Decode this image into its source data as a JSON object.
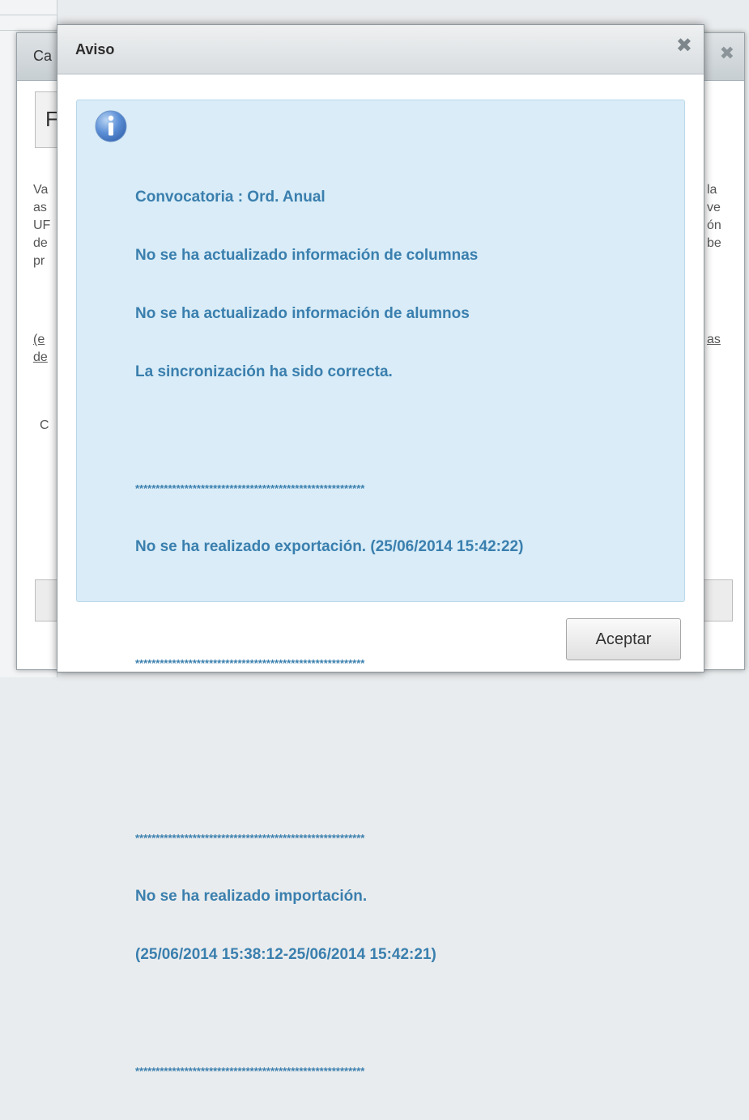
{
  "background_dialog": {
    "title": "Ca",
    "close_icon": "✖",
    "box_text": "F",
    "left_text": [
      "Va",
      "as",
      "UF",
      "de",
      "pr"
    ],
    "left_link": [
      "(e",
      "de"
    ],
    "left_c": "C",
    "right_text": [
      "la",
      "ve",
      "ón",
      "be"
    ],
    "right_link": "as"
  },
  "modal": {
    "title": "Aviso",
    "close_icon": "✖",
    "icon": "info-icon",
    "lines": [
      "Convocatoria : Ord. Anual",
      "No se ha actualizado información de columnas",
      "No se ha actualizado información de alumnos",
      "La sincronización ha sido correcta.",
      "",
      "********************************************************",
      "No se ha realizado exportación. (25/06/2014 15:42:22)",
      "",
      "********************************************************",
      "",
      "",
      "********************************************************",
      "No se ha realizado importación.",
      "(25/06/2014 15:38:12-25/06/2014 15:42:21)",
      "",
      "********************************************************"
    ],
    "accept_label": "Aceptar"
  },
  "colors": {
    "info_text": "#3a7fae",
    "info_bg": "#d9ecf7"
  }
}
